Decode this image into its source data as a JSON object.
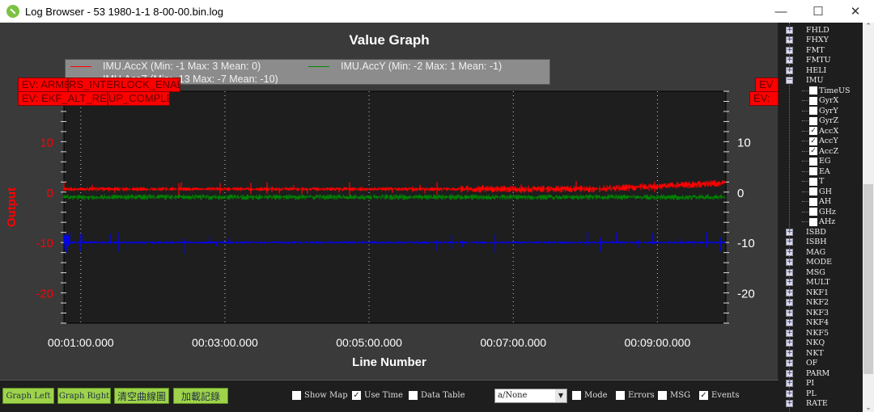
{
  "window": {
    "title": "Log Browser - 53 1980-1-1 8-00-00.bin.log",
    "minimize": "—",
    "maximize": "☐",
    "close": "✕"
  },
  "graph": {
    "title": "Value Graph",
    "xlabel": "Line Number",
    "ylabel": "Output"
  },
  "legend": [
    {
      "label": "IMU.AccX (Min: -1 Max: 3 Mean: 0)",
      "color": "#ff0000"
    },
    {
      "label": "IMU.AccY (Min: -2 Max: 1 Mean: -1)",
      "color": "#008000"
    },
    {
      "label": "IMU.AccZ (Min: -13 Max: -7 Mean: -10)",
      "color": "#0000ff"
    }
  ],
  "events_left": [
    "EV: ARMED",
    "RS_INTERLOCK_ENABLED",
    "EV: EKF_ALT_RESET",
    "UP_COMPLETE"
  ],
  "events_right": [
    "EV",
    "EV:"
  ],
  "chart_data": {
    "type": "line",
    "title": "Value Graph",
    "xlabel": "Line Number",
    "ylabel": "Output",
    "x_ticks": [
      "00:01:00.000",
      "00:03:00.000",
      "00:05:00.000",
      "00:07:00.000",
      "00:09:00.000"
    ],
    "y_ticks": [
      10,
      0,
      -10,
      -20
    ],
    "xlim": [
      "00:00:46",
      "00:09:57"
    ],
    "ylim": [
      -26,
      20
    ],
    "grid": true,
    "legend_placement": "top",
    "series": [
      {
        "name": "IMU.AccX",
        "color": "#ff0000",
        "min": -1,
        "max": 3,
        "mean": 0
      },
      {
        "name": "IMU.AccY",
        "color": "#008000",
        "min": -2,
        "max": 1,
        "mean": -1
      },
      {
        "name": "IMU.AccZ",
        "color": "#0000ff",
        "min": -13,
        "max": -7,
        "mean": -10
      }
    ]
  },
  "toolbar": {
    "buttons": [
      "Graph Left",
      "Graph Right",
      "清空曲線圖",
      "加載記錄"
    ],
    "show_map": {
      "label": "Show Map",
      "checked": false
    },
    "use_time": {
      "label": "Use Time",
      "checked": true
    },
    "data_table": {
      "label": "Data Table",
      "checked": false
    },
    "combo_value": "a/None",
    "mode": {
      "label": "Mode",
      "checked": false
    },
    "errors": {
      "label": "Errors",
      "checked": false
    },
    "msg": {
      "label": "MSG",
      "checked": false
    },
    "events": {
      "label": "Events",
      "checked": true
    }
  },
  "tree": {
    "before": [
      "FHLD",
      "FHXY",
      "FMT",
      "FMTU",
      "HELI"
    ],
    "expanded": "IMU",
    "children": [
      {
        "label": "TimeUS",
        "checked": false
      },
      {
        "label": "GyrX",
        "checked": false
      },
      {
        "label": "GyrY",
        "checked": false
      },
      {
        "label": "GyrZ",
        "checked": false
      },
      {
        "label": "AccX",
        "checked": true
      },
      {
        "label": "AccY",
        "checked": true
      },
      {
        "label": "AccZ",
        "checked": true
      },
      {
        "label": "EG",
        "checked": false
      },
      {
        "label": "EA",
        "checked": false
      },
      {
        "label": "T",
        "checked": false
      },
      {
        "label": "GH",
        "checked": false
      },
      {
        "label": "AH",
        "checked": false
      },
      {
        "label": "GHz",
        "checked": false
      },
      {
        "label": "AHz",
        "checked": false
      }
    ],
    "after": [
      "ISBD",
      "ISBH",
      "MAG",
      "MODE",
      "MSG",
      "MULT",
      "NKF1",
      "NKF2",
      "NKF3",
      "NKF4",
      "NKF5",
      "NKQ",
      "NKT",
      "OF",
      "PARM",
      "PI",
      "PL",
      "RATE"
    ]
  }
}
